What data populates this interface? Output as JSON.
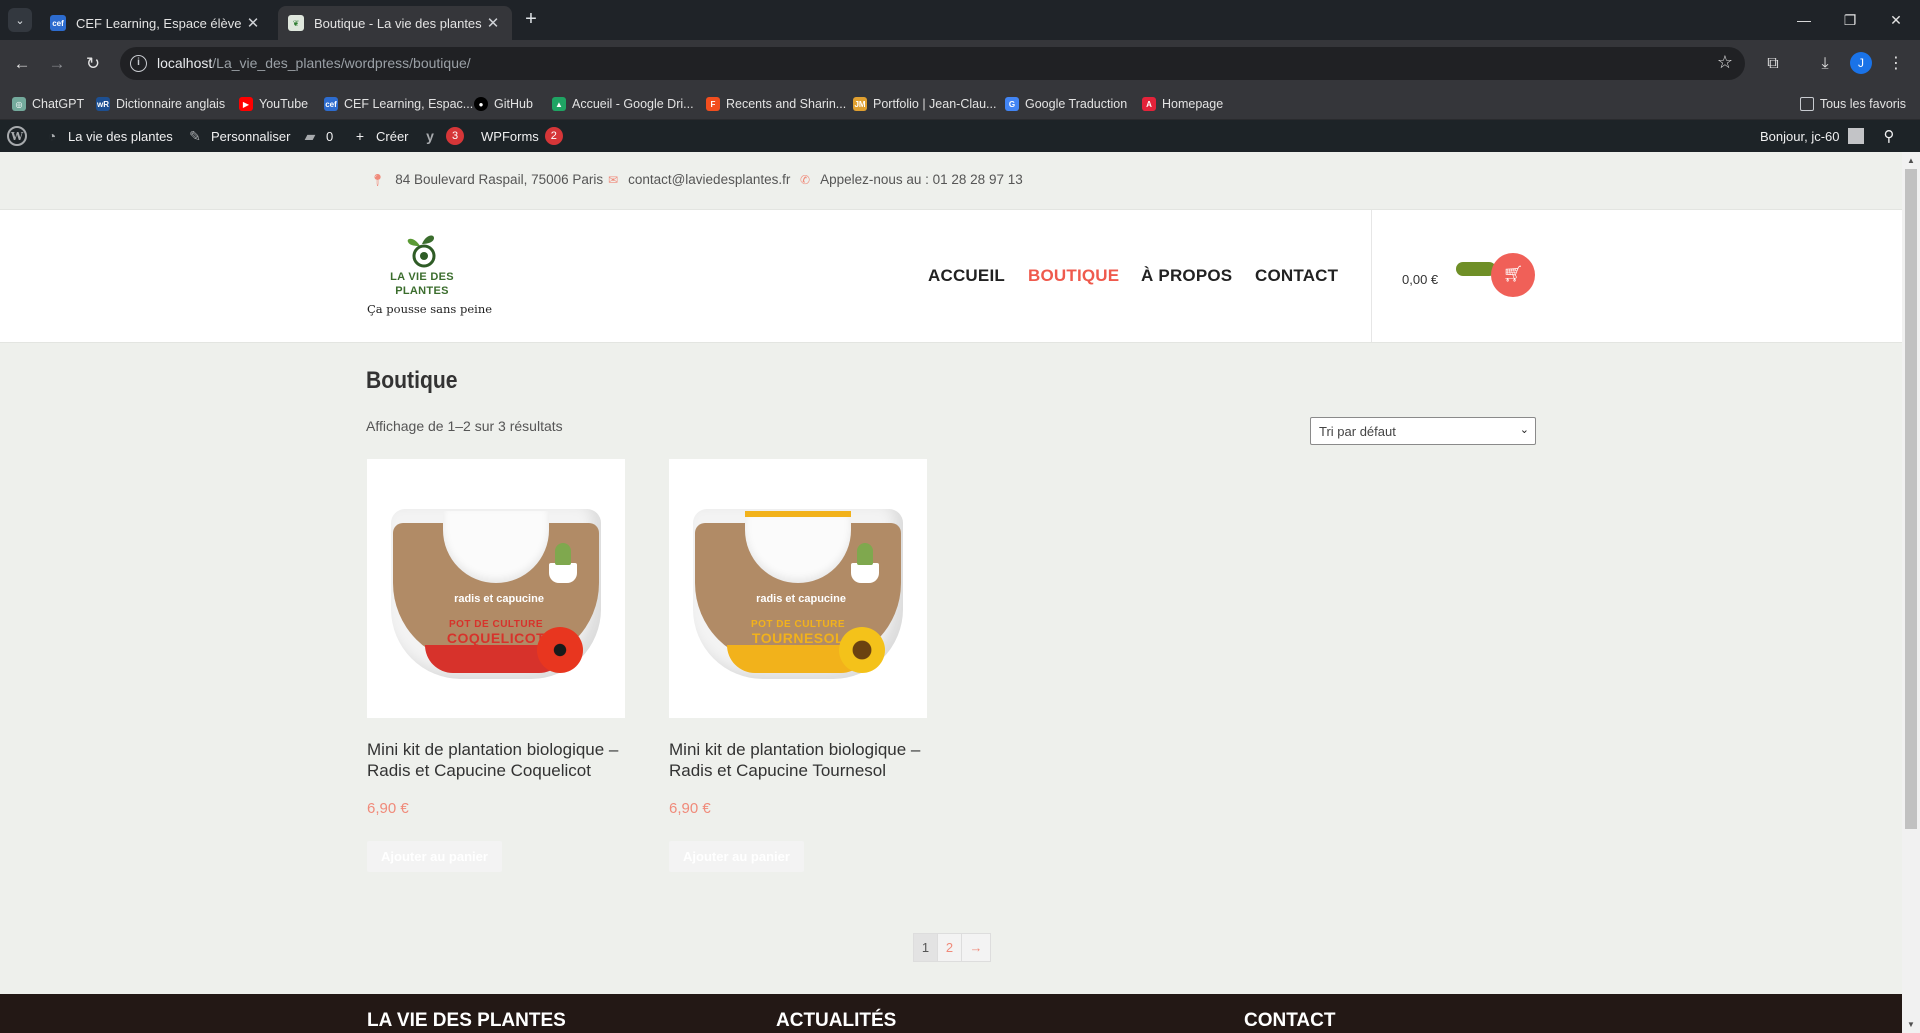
{
  "browser": {
    "tabs": [
      {
        "title": "CEF Learning, Espace élève du C",
        "active": false
      },
      {
        "title": "Boutique - La vie des plantes",
        "active": true
      }
    ],
    "url_host": "localhost",
    "url_path": "/La_vie_des_plantes/wordpress/boutique/",
    "profile_initial": "J",
    "bookmarks": [
      {
        "label": "ChatGPT",
        "icon": "chatgpt-icon"
      },
      {
        "label": "Dictionnaire anglais",
        "icon": "wordreference-icon"
      },
      {
        "label": "YouTube",
        "icon": "youtube-icon"
      },
      {
        "label": "CEF Learning, Espac...",
        "icon": "cef-icon"
      },
      {
        "label": "GitHub",
        "icon": "github-icon"
      },
      {
        "label": "Accueil - Google Dri...",
        "icon": "google-drive-icon"
      },
      {
        "label": "Recents and Sharin...",
        "icon": "figma-icon"
      },
      {
        "label": "Portfolio | Jean-Clau...",
        "icon": "portfolio-icon"
      },
      {
        "label": "Google Traduction",
        "icon": "google-translate-icon"
      },
      {
        "label": "Homepage",
        "icon": "homepage-icon"
      }
    ],
    "all_bookmarks": "Tous les favoris"
  },
  "adminbar": {
    "site_name": "La vie des plantes",
    "customize": "Personnaliser",
    "comments_count": "0",
    "new": "Créer",
    "yoast_count": "3",
    "wpforms": "WPForms",
    "wpforms_count": "2",
    "greeting": "Bonjour, jc-60"
  },
  "topbar": {
    "address": "84 Boulevard Raspail, 75006 Paris",
    "email": "contact@laviedesplantes.fr",
    "phone": "Appelez-nous au : 01 28 28 97 13"
  },
  "header": {
    "logo_line1": "LA VIE DES",
    "logo_line2": "PLANTES",
    "tagline": "Ça pousse sans peine",
    "nav": [
      "ACCUEIL",
      "BOUTIQUE",
      "À PROPOS",
      "CONTACT"
    ],
    "active_nav": "BOUTIQUE",
    "cart_amount": "0,00 €"
  },
  "shop": {
    "title": "Boutique",
    "result_count": "Affichage de 1–2 sur 3 résultats",
    "sort_selected": "Tri par défaut",
    "products": [
      {
        "title": "Mini kit de plantation biologique – Radis et Capucine Coquelicot",
        "price": "6,90 €",
        "button": "Ajouter au panier",
        "pot_brand": "radis et capucine",
        "pot_line1": "POT DE CULTURE",
        "pot_line2": "COQUELICOT",
        "accent": "#d7322b"
      },
      {
        "title": "Mini kit de plantation biologique – Radis et Capucine Tournesol",
        "price": "6,90 €",
        "button": "Ajouter au panier",
        "pot_brand": "radis et capucine",
        "pot_line1": "POT DE CULTURE",
        "pot_line2": "TOURNESOL",
        "accent": "#f2b21b"
      }
    ],
    "pagination": [
      "1",
      "2",
      "→"
    ],
    "current_page": "1"
  },
  "footer": {
    "headings": [
      "LA VIE DES PLANTES",
      "ACTUALITÉS",
      "CONTACT"
    ]
  },
  "colors": {
    "accent": "#ef5a4d",
    "price": "#f08a7a",
    "brand_green": "#3b6d2d",
    "toggle_green": "#6f8f27"
  }
}
